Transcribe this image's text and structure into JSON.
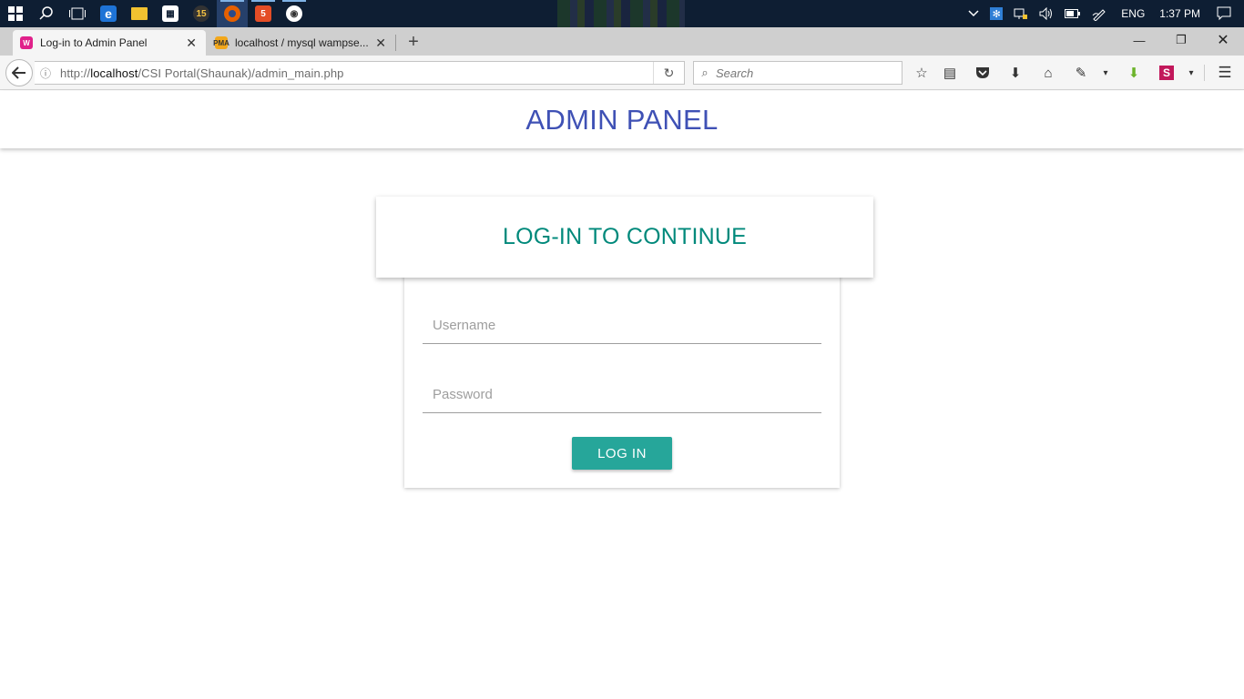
{
  "taskbar": {
    "start_icon": "windows-logo-icon",
    "apps": [
      {
        "name": "search-icon",
        "glyph": "⌕"
      },
      {
        "name": "task-view-icon",
        "glyph": "▭"
      },
      {
        "name": "edge-icon",
        "glyph": "e"
      },
      {
        "name": "file-explorer-icon",
        "glyph": "▬"
      },
      {
        "name": "store-icon",
        "glyph": "▦"
      },
      {
        "name": "app-15-icon",
        "glyph": "15"
      },
      {
        "name": "firefox-icon",
        "glyph": "●"
      },
      {
        "name": "html5-icon",
        "glyph": "5"
      },
      {
        "name": "app-icon",
        "glyph": "◉"
      }
    ],
    "tray": {
      "language": "ENG",
      "time": "1:37 PM"
    }
  },
  "browser": {
    "tabs": [
      {
        "title": "Log-in to Admin Panel",
        "active": true
      },
      {
        "title": "localhost / mysql wampse...",
        "active": false
      }
    ],
    "url": {
      "prefix": "http://",
      "host": "localhost",
      "path": "/CSI Portal(Shaunak)/admin_main.php"
    },
    "search_placeholder": "Search"
  },
  "page": {
    "header_title": "ADMIN PANEL",
    "card_title": "LOG-IN TO CONTINUE",
    "username_placeholder": "Username",
    "password_placeholder": "Password",
    "login_label": "LOG IN"
  },
  "colors": {
    "header_title": "#3f51b5",
    "card_title": "#00897b",
    "button": "#26a69a",
    "taskbar": "#0e1e33"
  }
}
